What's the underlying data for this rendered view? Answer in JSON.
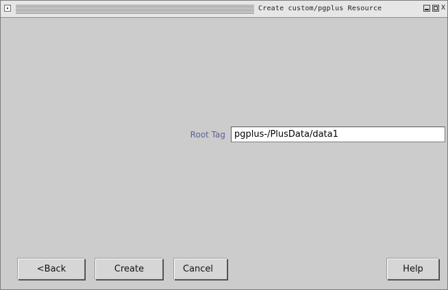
{
  "window": {
    "title": "Create custom/pgplus Resource",
    "close_glyph": "X"
  },
  "form": {
    "root_tag_label": "Root Tag",
    "root_tag_value": "pgplus-/PlusData/data1"
  },
  "buttons": {
    "back": "<Back",
    "create": "Create",
    "cancel": "Cancel",
    "help": "Help"
  },
  "colors": {
    "window_bg": "#cccccc",
    "label_color": "#5d5f9b",
    "input_bg": "#ffffff"
  }
}
